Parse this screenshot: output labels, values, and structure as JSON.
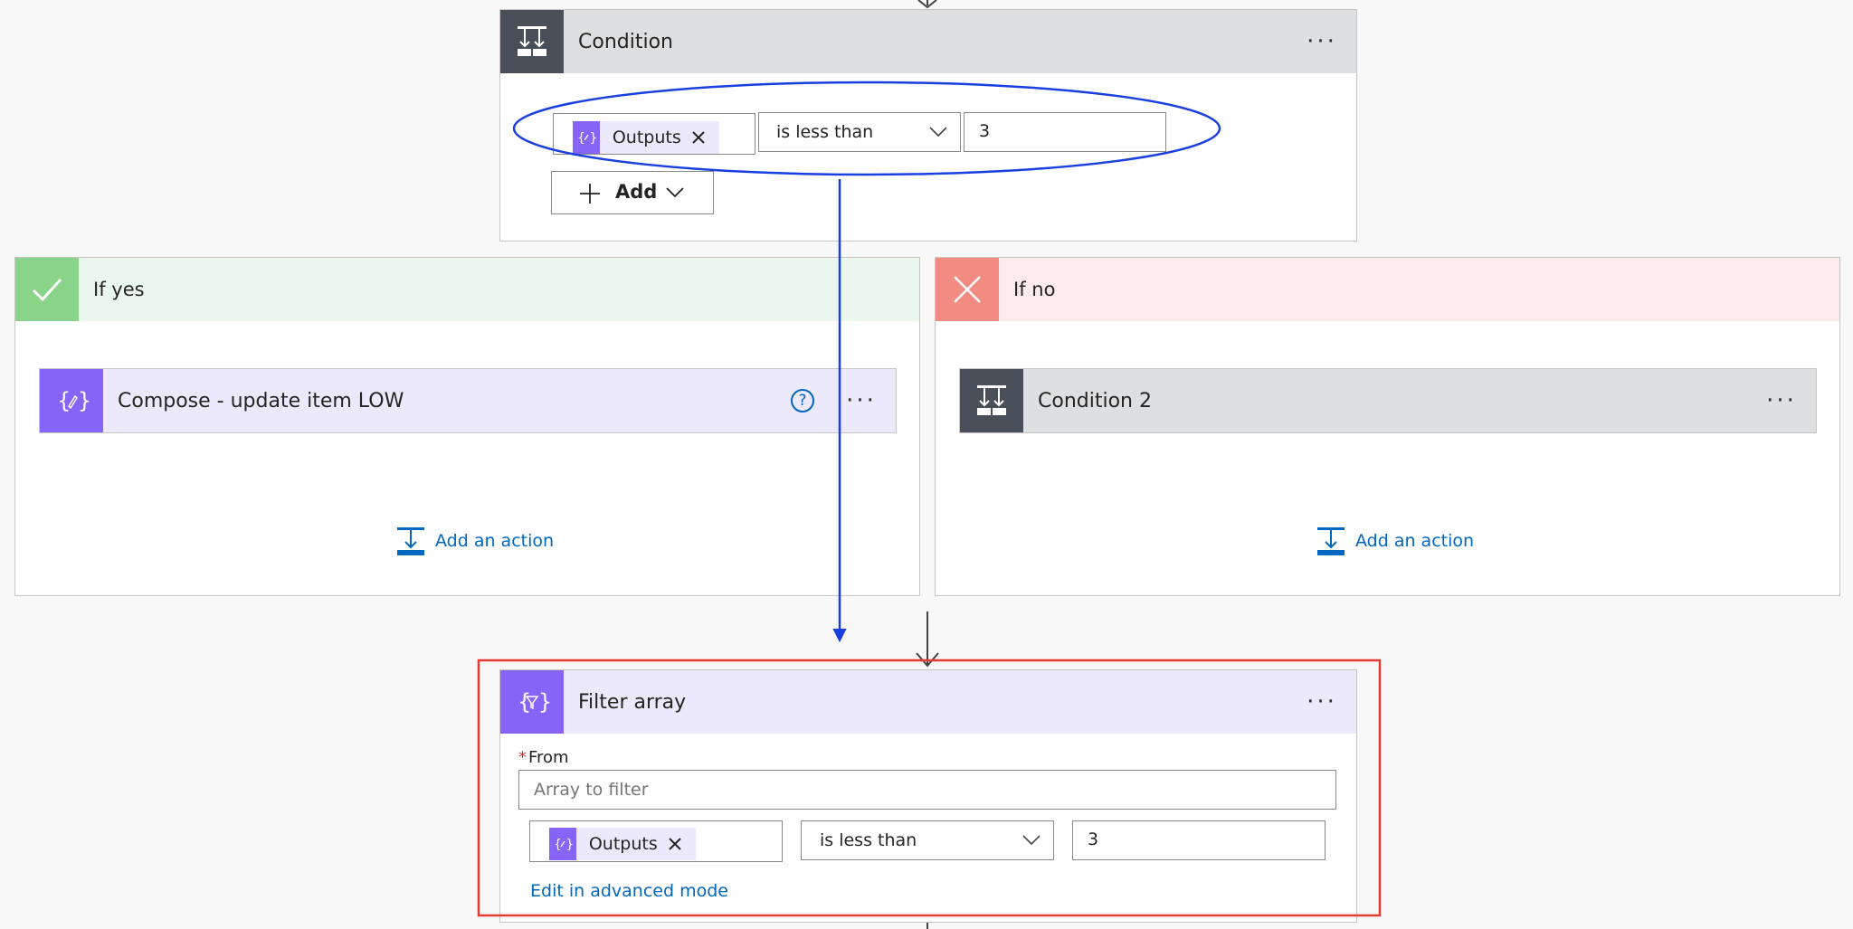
{
  "condition": {
    "title": "Condition",
    "token_label": "Outputs",
    "operator": "is less than",
    "value": "3",
    "add_label": "Add"
  },
  "branch_yes": {
    "label": "If yes",
    "action_title": "Compose - update item LOW",
    "add_action": "Add an action"
  },
  "branch_no": {
    "label": "If no",
    "action_title": "Condition 2",
    "add_action": "Add an action"
  },
  "filter_array": {
    "title": "Filter array",
    "required_mark": "*",
    "from_label": "From",
    "from_placeholder": "Array to filter",
    "token_label": "Outputs",
    "operator": "is less than",
    "value": "3",
    "advanced_link": "Edit in advanced mode"
  },
  "icons": {
    "condition": "condition-icon",
    "compose": "compose-icon",
    "filter": "filter-array-icon",
    "check": "check-icon",
    "cross": "cross-icon",
    "add_action": "add-action-icon",
    "help": "help-icon"
  },
  "colors": {
    "condition_dark": "#484f58",
    "condition_header": "#dedfe0",
    "data_op_purple": "#8764f8",
    "data_op_header": "#ece9fd",
    "yes_green": "#8ad48a",
    "yes_header": "#eaf7ec",
    "no_red": "#f28b82",
    "no_header": "#fdeaea",
    "link_blue": "#0067c0",
    "annotation_blue": "#1a3fe0",
    "highlight_red": "#e53b2f"
  }
}
